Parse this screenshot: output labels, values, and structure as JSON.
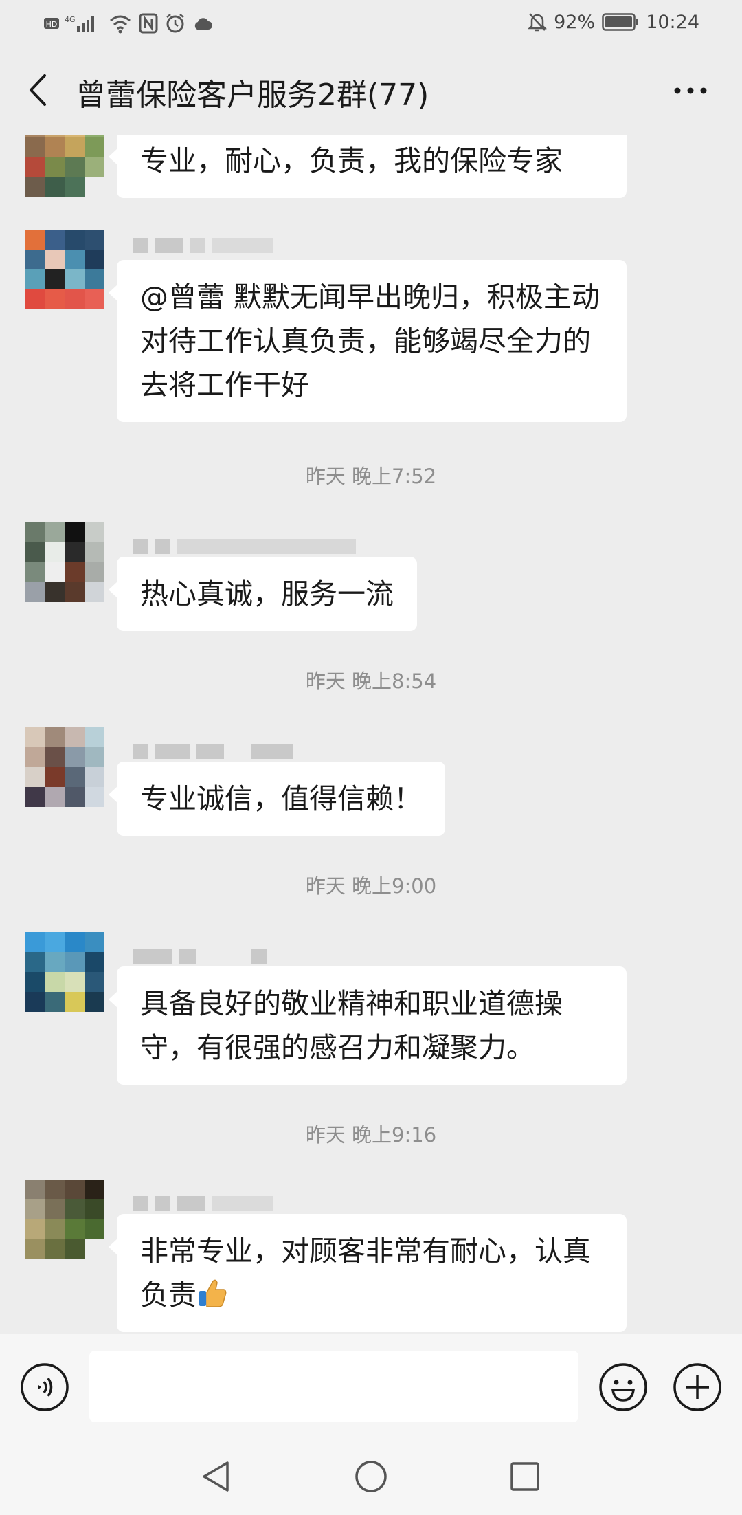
{
  "status_bar": {
    "left_indicators": "HD 4G",
    "battery": "92%",
    "time": "10:24"
  },
  "header": {
    "title": "曾蕾保险客户服务2群(77)"
  },
  "messages": [
    {
      "text": "专业，耐心，负责，我的保险专家"
    },
    {
      "text": "@曾蕾  默默无闻早出晚归，积极主动对待工作认真负责，能够竭尽全力的去将工作干好"
    },
    {
      "timestamp": "昨天 晚上7:52",
      "text": "热心真诚，服务一流"
    },
    {
      "timestamp": "昨天 晚上8:54",
      "text": "专业诚信，值得信赖！"
    },
    {
      "timestamp": "昨天 晚上9:00",
      "text": "具备良好的敬业精神和职业道德操守，有很强的感召力和凝聚力。"
    },
    {
      "timestamp": "昨天 晚上9:16",
      "text": "非常专业，对顾客非常有耐心，认真负责",
      "emoji": "thumbs-up"
    }
  ],
  "input": {
    "value": "",
    "placeholder": ""
  },
  "icons": {
    "back": "chevron-left-icon",
    "more": "more-dots-icon",
    "voice": "voice-icon",
    "emoji": "smiley-icon",
    "add": "plus-circle-icon"
  },
  "colors": {
    "background": "#ededed",
    "bubble": "#ffffff",
    "timestamp": "#8e8e8e"
  }
}
